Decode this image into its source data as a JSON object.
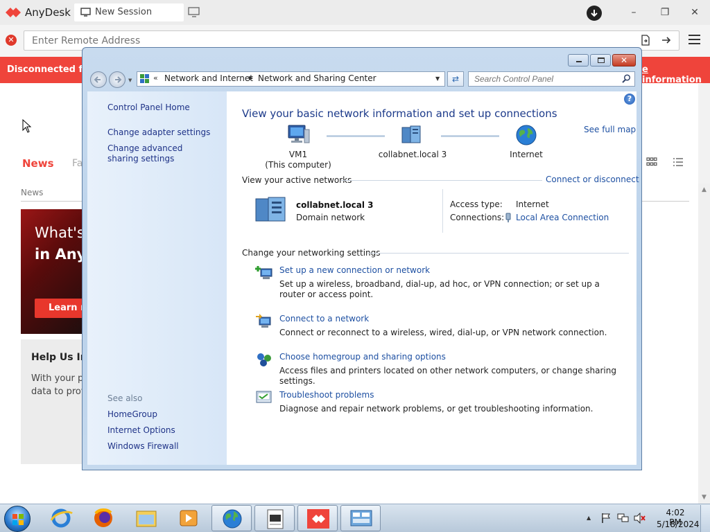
{
  "anydesk": {
    "app_name": "AnyDesk",
    "tab_label": "New Session",
    "address_placeholder": "Enter Remote Address",
    "banner_text": "Disconnected fro",
    "banner_link": "e information",
    "news_tab": "News",
    "fav_tab": "Fa",
    "news_section_label": "News",
    "promo_line1": "What's",
    "promo_line2": "in Any",
    "promo_button": "Learn m",
    "help_title": "Help Us In",
    "help_line1": "With your p",
    "help_line2": "data to prov",
    "colors": {
      "brand_red": "#ef443b"
    }
  },
  "window": {
    "breadcrumb": [
      "Network and Internet",
      "Network and Sharing Center"
    ],
    "search_placeholder": "Search Control Panel",
    "left_pane": {
      "links": [
        "Control Panel Home",
        "Change adapter settings",
        "Change advanced sharing settings"
      ],
      "see_also_label": "See also",
      "see_also": [
        "HomeGroup",
        "Internet Options",
        "Windows Firewall"
      ]
    },
    "main": {
      "title": "View your basic network information and set up connections",
      "see_full_map": "See full map",
      "map": [
        {
          "label": "VM1",
          "sublabel": "(This computer)",
          "icon": "computer-icon"
        },
        {
          "label": "collabnet.local  3",
          "icon": "domain-network-icon"
        },
        {
          "label": "Internet",
          "icon": "globe-icon"
        }
      ],
      "active_networks_head": "View your active networks",
      "connect_or_disconnect": "Connect or disconnect",
      "network": {
        "name": "collabnet.local  3",
        "type": "Domain network",
        "access_type_label": "Access type:",
        "access_type_value": "Internet",
        "connections_label": "Connections:",
        "connections_value": "Local Area Connection"
      },
      "settings_head": "Change your networking settings",
      "tasks": [
        {
          "link": "Set up a new connection or network",
          "desc": "Set up a wireless, broadband, dial-up, ad hoc, or VPN connection; or set up a router or access point."
        },
        {
          "link": "Connect to a network",
          "desc": "Connect or reconnect to a wireless, wired, dial-up, or VPN network connection."
        },
        {
          "link": "Choose homegroup and sharing options",
          "desc": "Access files and printers located on other network computers, or change sharing settings."
        },
        {
          "link": "Troubleshoot problems",
          "desc": "Diagnose and repair network problems, or get troubleshooting information."
        }
      ]
    }
  },
  "taskbar": {
    "apps": [
      "internet-explorer",
      "firefox",
      "windows-explorer",
      "media-player",
      "network-globe",
      "document-viewer",
      "anydesk",
      "control-panel"
    ],
    "clock_time": "4:02 PM",
    "clock_date": "5/18/2024"
  }
}
